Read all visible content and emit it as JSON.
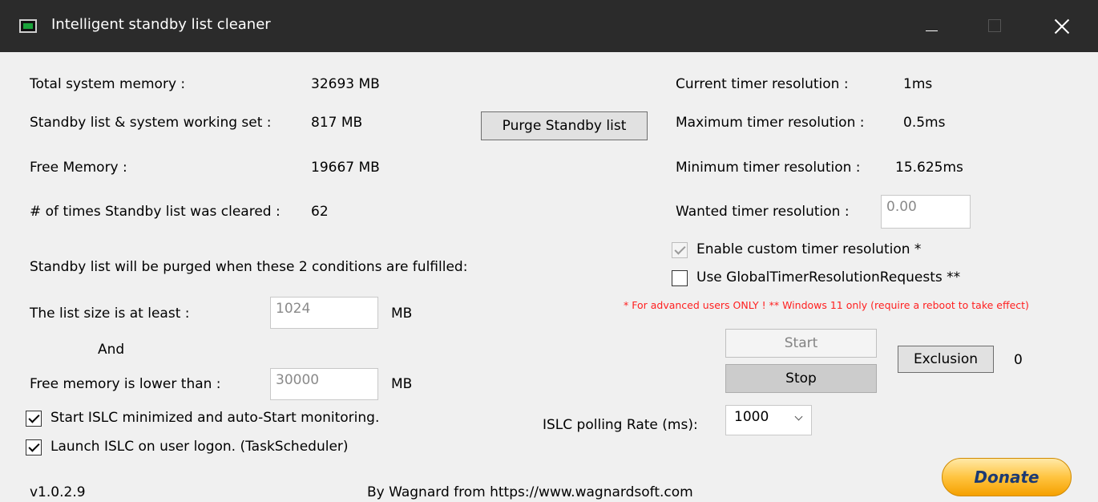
{
  "window": {
    "title": "Intelligent standby list cleaner"
  },
  "memory": {
    "total_label": "Total system memory :",
    "total_value": "32693 MB",
    "standby_label": "Standby list & system working set :",
    "standby_value": "817 MB",
    "free_label": "Free Memory :",
    "free_value": "19667 MB",
    "cleared_label": "# of times Standby list was cleared :",
    "cleared_value": "62"
  },
  "purge_button": "Purge Standby list",
  "timer": {
    "current_label": "Current timer resolution :",
    "current_value": "1ms",
    "maximum_label": "Maximum timer resolution :",
    "maximum_value": "0.5ms",
    "minimum_label": "Minimum timer resolution :",
    "minimum_value": "15.625ms",
    "wanted_label": "Wanted timer resolution :",
    "wanted_value": "0.00",
    "enable_custom_label": "Enable custom timer resolution *",
    "enable_custom_checked": true,
    "global_requests_label": "Use GlobalTimerResolutionRequests **",
    "global_requests_checked": false,
    "note": "* For advanced users ONLY !  ** Windows 11 only (require a reboot to take effect)"
  },
  "conditions": {
    "heading": "Standby list will be purged when these 2 conditions are fulfilled:",
    "list_size_label": "The list size is at least :",
    "list_size_value": "1024",
    "list_size_unit": "MB",
    "and_label": "And",
    "free_mem_label": "Free memory is lower than :",
    "free_mem_value": "30000",
    "free_mem_unit": "MB"
  },
  "options": {
    "start_minimized_label": "Start ISLC minimized and auto-Start monitoring.",
    "start_minimized_checked": true,
    "launch_logon_label": "Launch ISLC on user logon. (TaskScheduler)",
    "launch_logon_checked": true
  },
  "controls": {
    "start_label": "Start",
    "stop_label": "Stop",
    "exclusion_label": "Exclusion",
    "exclusion_count": "0",
    "polling_label": "ISLC polling Rate (ms):",
    "polling_value": "1000"
  },
  "footer": {
    "version": "v1.0.2.9",
    "credit": "By Wagnard from https://www.wagnardsoft.com",
    "donate_label": "Donate"
  }
}
